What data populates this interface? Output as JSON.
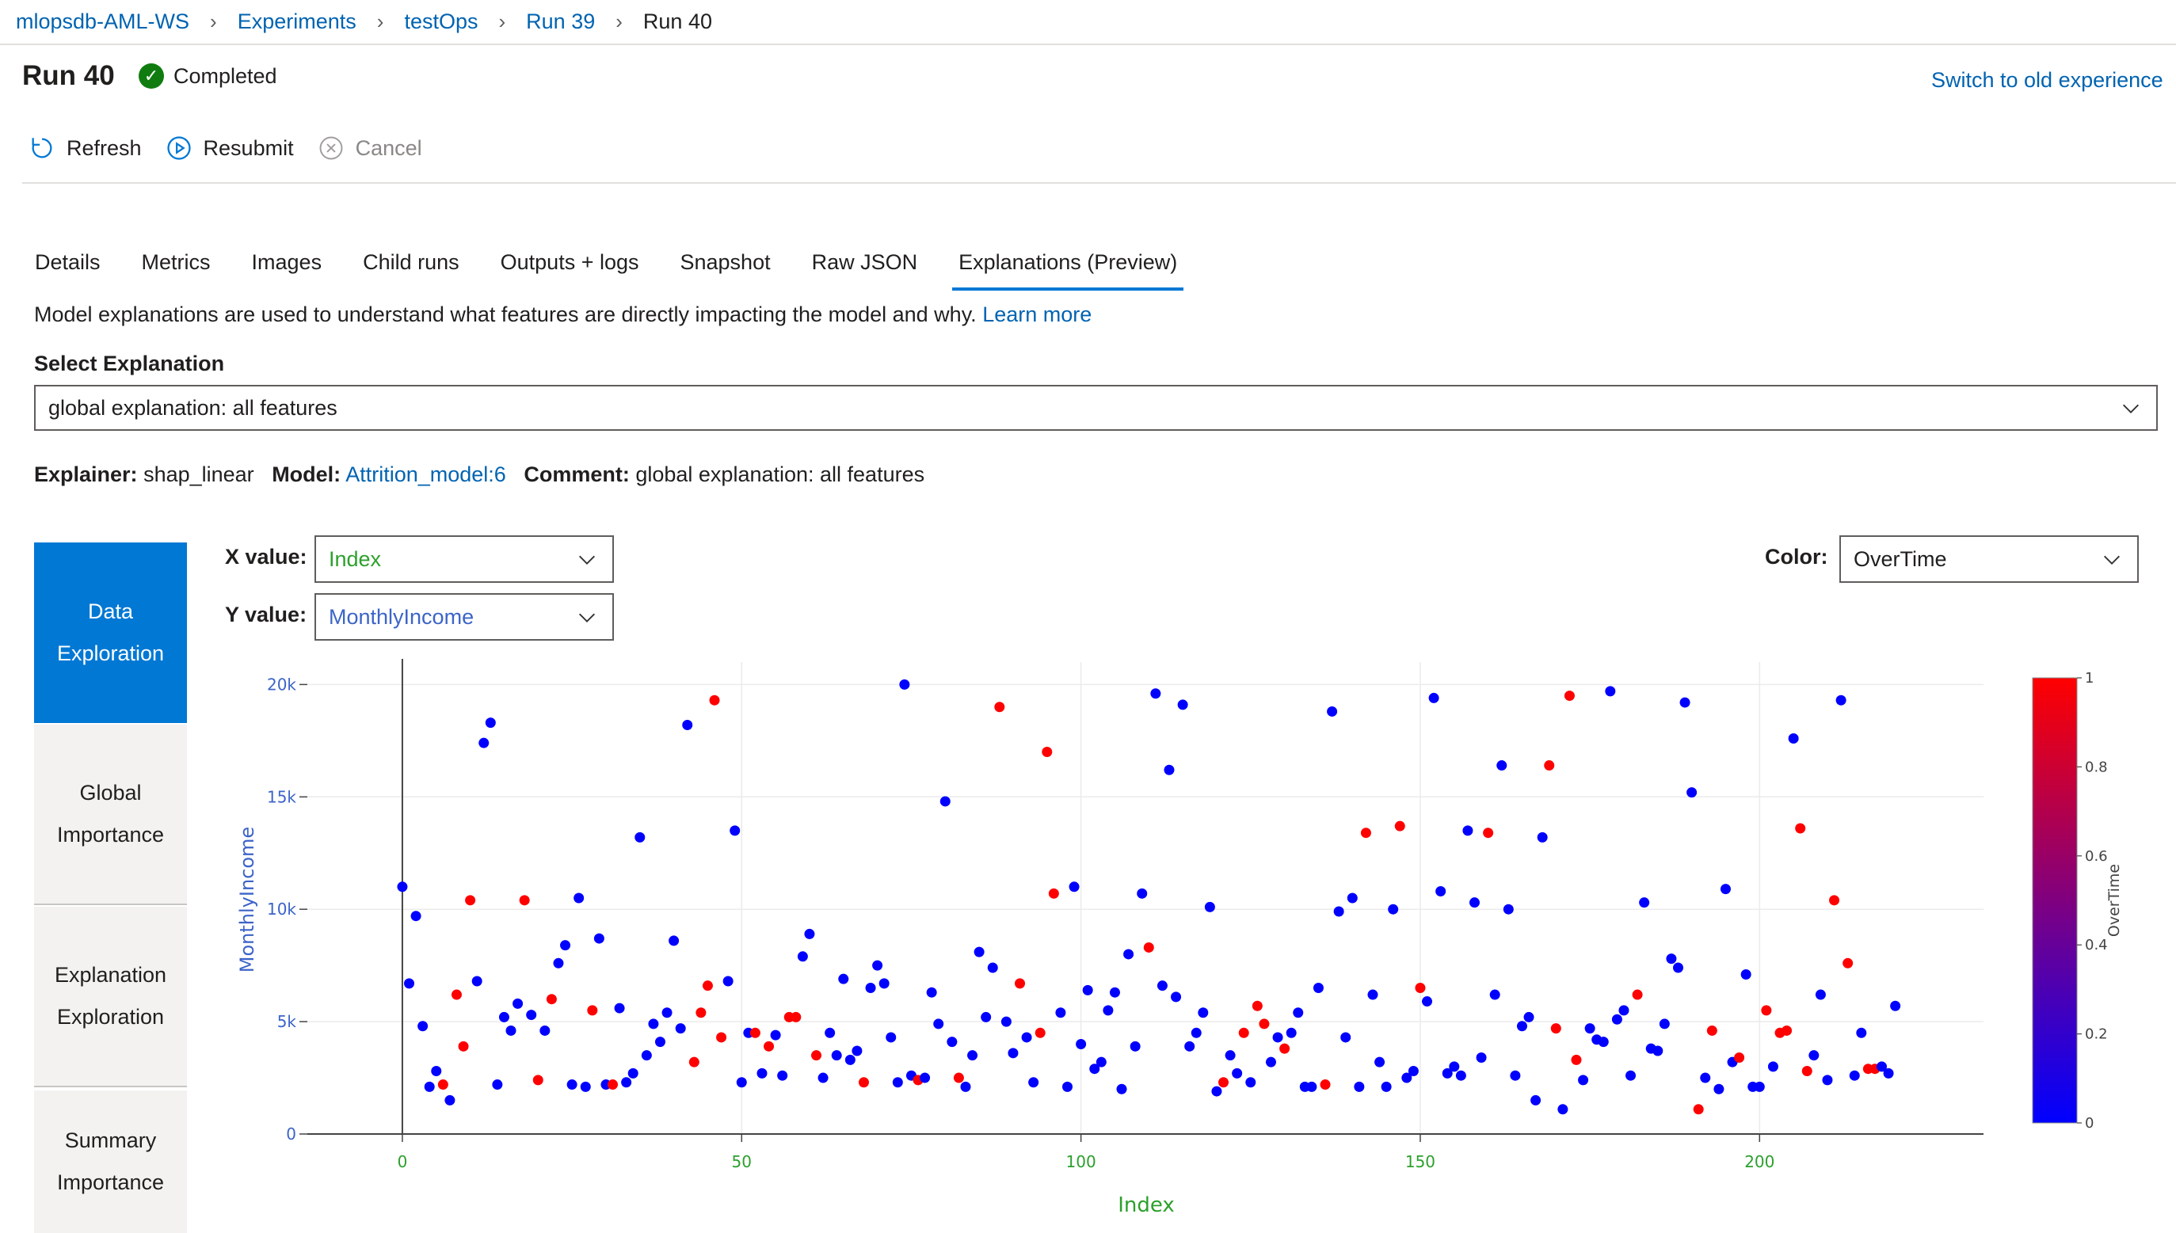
{
  "breadcrumb": [
    "mlopsdb-AML-WS",
    "Experiments",
    "testOps",
    "Run 39",
    "Run 40"
  ],
  "run": {
    "title": "Run 40",
    "status": "Completed"
  },
  "switch_link": "Switch to old experience",
  "commands": {
    "refresh": "Refresh",
    "resubmit": "Resubmit",
    "cancel": "Cancel"
  },
  "tabs": [
    "Details",
    "Metrics",
    "Images",
    "Child runs",
    "Outputs + logs",
    "Snapshot",
    "Raw JSON",
    "Explanations (Preview)"
  ],
  "description": {
    "text": "Model explanations are used to understand what features are directly impacting the model and why.",
    "link": "Learn more"
  },
  "select_explanation": {
    "label": "Select Explanation",
    "value": "global explanation: all features"
  },
  "meta": {
    "explainer_label": "Explainer:",
    "explainer": "shap_linear",
    "model_label": "Model:",
    "model": "Attrition_model:6",
    "comment_label": "Comment:",
    "comment": "global explanation: all features"
  },
  "nav": {
    "data_exploration": [
      "Data",
      "Exploration"
    ],
    "global_importance": [
      "Global",
      "Importance"
    ],
    "explanation_exploration": [
      "Explanation",
      "Exploration"
    ],
    "summary_importance": [
      "Summary",
      "Importance"
    ]
  },
  "controls": {
    "x_label": "X value:",
    "x_value": "Index",
    "y_label": "Y value:",
    "y_value": "MonthlyIncome",
    "color_label": "Color:",
    "color_value": "OverTime"
  },
  "colors": {
    "accent": "#0078d4",
    "link": "#0063b1",
    "x_axis": "#2ca02c",
    "y_axis": "#3c64c8",
    "overtime_no": "#0000ff",
    "overtime_yes": "#ff0000"
  },
  "chart_data": {
    "type": "scatter",
    "xlabel": "Index",
    "ylabel": "MonthlyIncome",
    "xlim": [
      -14,
      233
    ],
    "ylim": [
      0,
      21000
    ],
    "x_ticks": [
      0,
      50,
      100,
      150,
      200
    ],
    "y_ticks": [
      {
        "value": 0,
        "label": "0"
      },
      {
        "value": 5000,
        "label": "5k"
      },
      {
        "value": 10000,
        "label": "10k"
      },
      {
        "value": 15000,
        "label": "15k"
      },
      {
        "value": 20000,
        "label": "20k"
      }
    ],
    "colorbar": {
      "title": "OverTime",
      "range": [
        0,
        1
      ],
      "ticks": [
        "0",
        "0.2",
        "0.4",
        "0.6",
        "0.8",
        "1"
      ]
    },
    "points": [
      [
        0,
        11000,
        0
      ],
      [
        1,
        6700,
        0
      ],
      [
        2,
        9700,
        0
      ],
      [
        3,
        4800,
        0
      ],
      [
        4,
        2100,
        0
      ],
      [
        5,
        2800,
        0
      ],
      [
        6,
        2200,
        1
      ],
      [
        7,
        1500,
        0
      ],
      [
        8,
        6200,
        1
      ],
      [
        9,
        3900,
        1
      ],
      [
        10,
        10400,
        1
      ],
      [
        11,
        6800,
        0
      ],
      [
        12,
        17400,
        0
      ],
      [
        13,
        18300,
        0
      ],
      [
        14,
        2200,
        0
      ],
      [
        15,
        5200,
        0
      ],
      [
        16,
        4600,
        0
      ],
      [
        17,
        5800,
        0
      ],
      [
        18,
        10400,
        1
      ],
      [
        19,
        5300,
        0
      ],
      [
        20,
        2400,
        1
      ],
      [
        21,
        4600,
        0
      ],
      [
        22,
        6000,
        1
      ],
      [
        23,
        7600,
        0
      ],
      [
        24,
        8400,
        0
      ],
      [
        25,
        2200,
        0
      ],
      [
        26,
        10500,
        0
      ],
      [
        27,
        2100,
        0
      ],
      [
        28,
        5500,
        1
      ],
      [
        29,
        8700,
        0
      ],
      [
        30,
        2200,
        0
      ],
      [
        31,
        2200,
        1
      ],
      [
        32,
        5600,
        0
      ],
      [
        33,
        2300,
        0
      ],
      [
        34,
        2700,
        0
      ],
      [
        35,
        13200,
        0
      ],
      [
        36,
        3500,
        0
      ],
      [
        37,
        4900,
        0
      ],
      [
        38,
        4100,
        0
      ],
      [
        39,
        5400,
        0
      ],
      [
        40,
        8600,
        0
      ],
      [
        41,
        4700,
        0
      ],
      [
        42,
        18200,
        0
      ],
      [
        43,
        3200,
        1
      ],
      [
        44,
        5400,
        1
      ],
      [
        45,
        6600,
        1
      ],
      [
        46,
        19300,
        1
      ],
      [
        47,
        4300,
        1
      ],
      [
        48,
        6800,
        0
      ],
      [
        49,
        13500,
        0
      ],
      [
        50,
        2300,
        0
      ],
      [
        51,
        4500,
        0
      ],
      [
        52,
        4500,
        1
      ],
      [
        53,
        2700,
        0
      ],
      [
        54,
        3900,
        1
      ],
      [
        55,
        4400,
        0
      ],
      [
        56,
        2600,
        0
      ],
      [
        57,
        5200,
        1
      ],
      [
        58,
        5200,
        1
      ],
      [
        59,
        7900,
        0
      ],
      [
        60,
        8900,
        0
      ],
      [
        61,
        3500,
        1
      ],
      [
        62,
        2500,
        0
      ],
      [
        63,
        4500,
        0
      ],
      [
        64,
        3500,
        0
      ],
      [
        65,
        6900,
        0
      ],
      [
        66,
        3300,
        0
      ],
      [
        67,
        3700,
        0
      ],
      [
        68,
        2300,
        1
      ],
      [
        69,
        6500,
        0
      ],
      [
        70,
        7500,
        0
      ],
      [
        71,
        6700,
        0
      ],
      [
        72,
        4300,
        0
      ],
      [
        73,
        2300,
        0
      ],
      [
        74,
        20000,
        0
      ],
      [
        75,
        2600,
        0
      ],
      [
        76,
        2400,
        1
      ],
      [
        77,
        2500,
        0
      ],
      [
        78,
        6300,
        0
      ],
      [
        79,
        4900,
        0
      ],
      [
        80,
        14800,
        0
      ],
      [
        81,
        4100,
        0
      ],
      [
        82,
        2500,
        1
      ],
      [
        83,
        2100,
        0
      ],
      [
        84,
        3500,
        0
      ],
      [
        85,
        8100,
        0
      ],
      [
        86,
        5200,
        0
      ],
      [
        87,
        7400,
        0
      ],
      [
        88,
        19000,
        1
      ],
      [
        89,
        5000,
        0
      ],
      [
        90,
        3600,
        0
      ],
      [
        91,
        6700,
        1
      ],
      [
        92,
        4300,
        0
      ],
      [
        93,
        2300,
        0
      ],
      [
        94,
        4500,
        1
      ],
      [
        95,
        17000,
        1
      ],
      [
        96,
        10700,
        1
      ],
      [
        97,
        5400,
        0
      ],
      [
        98,
        2100,
        0
      ],
      [
        99,
        11000,
        0
      ],
      [
        100,
        4000,
        0
      ],
      [
        101,
        6400,
        0
      ],
      [
        102,
        2900,
        0
      ],
      [
        103,
        3200,
        0
      ],
      [
        104,
        5500,
        0
      ],
      [
        105,
        6300,
        0
      ],
      [
        106,
        2000,
        0
      ],
      [
        107,
        8000,
        0
      ],
      [
        108,
        3900,
        0
      ],
      [
        109,
        10700,
        0
      ],
      [
        110,
        8300,
        1
      ],
      [
        111,
        19600,
        0
      ],
      [
        112,
        6600,
        0
      ],
      [
        113,
        16200,
        0
      ],
      [
        114,
        6100,
        0
      ],
      [
        115,
        19100,
        0
      ],
      [
        116,
        3900,
        0
      ],
      [
        117,
        4500,
        0
      ],
      [
        118,
        5400,
        0
      ],
      [
        119,
        10100,
        0
      ],
      [
        120,
        1900,
        0
      ],
      [
        121,
        2300,
        1
      ],
      [
        122,
        3500,
        0
      ],
      [
        123,
        2700,
        0
      ],
      [
        124,
        4500,
        1
      ],
      [
        125,
        2300,
        0
      ],
      [
        126,
        5700,
        1
      ],
      [
        127,
        4900,
        1
      ],
      [
        128,
        3200,
        0
      ],
      [
        129,
        4300,
        0
      ],
      [
        130,
        3800,
        1
      ],
      [
        131,
        4500,
        0
      ],
      [
        132,
        5400,
        0
      ],
      [
        133,
        2100,
        0
      ],
      [
        134,
        2100,
        0
      ],
      [
        135,
        6500,
        0
      ],
      [
        136,
        2200,
        1
      ],
      [
        137,
        18800,
        0
      ],
      [
        138,
        9900,
        0
      ],
      [
        139,
        4300,
        0
      ],
      [
        140,
        10500,
        0
      ],
      [
        141,
        2100,
        0
      ],
      [
        142,
        13400,
        1
      ],
      [
        143,
        6200,
        0
      ],
      [
        144,
        3200,
        0
      ],
      [
        145,
        2100,
        0
      ],
      [
        146,
        10000,
        0
      ],
      [
        147,
        13700,
        1
      ],
      [
        148,
        2500,
        0
      ],
      [
        149,
        2800,
        0
      ],
      [
        150,
        6500,
        1
      ],
      [
        151,
        5900,
        0
      ],
      [
        152,
        19400,
        0
      ],
      [
        153,
        10800,
        0
      ],
      [
        154,
        2700,
        0
      ],
      [
        155,
        3000,
        0
      ],
      [
        156,
        2600,
        0
      ],
      [
        157,
        13500,
        0
      ],
      [
        158,
        10300,
        0
      ],
      [
        159,
        3400,
        0
      ],
      [
        160,
        13400,
        1
      ],
      [
        161,
        6200,
        0
      ],
      [
        162,
        16400,
        0
      ],
      [
        163,
        10000,
        0
      ],
      [
        164,
        2600,
        0
      ],
      [
        165,
        4800,
        0
      ],
      [
        166,
        5200,
        0
      ],
      [
        167,
        1500,
        0
      ],
      [
        168,
        13200,
        0
      ],
      [
        169,
        16400,
        1
      ],
      [
        170,
        4700,
        1
      ],
      [
        171,
        1100,
        0
      ],
      [
        172,
        19500,
        1
      ],
      [
        173,
        3300,
        1
      ],
      [
        174,
        2400,
        0
      ],
      [
        175,
        4700,
        0
      ],
      [
        176,
        4200,
        0
      ],
      [
        177,
        4100,
        0
      ],
      [
        178,
        19700,
        0
      ],
      [
        179,
        5100,
        0
      ],
      [
        180,
        5500,
        0
      ],
      [
        181,
        2600,
        0
      ],
      [
        182,
        6200,
        1
      ],
      [
        183,
        10300,
        0
      ],
      [
        184,
        3800,
        0
      ],
      [
        185,
        3700,
        0
      ],
      [
        186,
        4900,
        0
      ],
      [
        187,
        7800,
        0
      ],
      [
        188,
        7400,
        0
      ],
      [
        189,
        19200,
        0
      ],
      [
        190,
        15200,
        0
      ],
      [
        191,
        1100,
        1
      ],
      [
        192,
        2500,
        0
      ],
      [
        193,
        4600,
        1
      ],
      [
        194,
        2000,
        0
      ],
      [
        195,
        10900,
        0
      ],
      [
        196,
        3200,
        0
      ],
      [
        197,
        3400,
        1
      ],
      [
        198,
        7100,
        0
      ],
      [
        199,
        2100,
        0
      ],
      [
        200,
        2100,
        0
      ],
      [
        201,
        5500,
        1
      ],
      [
        202,
        3000,
        0
      ],
      [
        203,
        4500,
        1
      ],
      [
        204,
        4600,
        1
      ],
      [
        205,
        17600,
        0
      ],
      [
        206,
        13600,
        1
      ],
      [
        207,
        2800,
        1
      ],
      [
        208,
        3500,
        0
      ],
      [
        209,
        6200,
        0
      ],
      [
        210,
        2400,
        0
      ],
      [
        211,
        10400,
        1
      ],
      [
        212,
        19300,
        0
      ],
      [
        213,
        7600,
        1
      ],
      [
        214,
        2600,
        0
      ],
      [
        215,
        4500,
        0
      ],
      [
        216,
        2900,
        1
      ],
      [
        217,
        2900,
        1
      ],
      [
        218,
        3000,
        0
      ],
      [
        219,
        2700,
        0
      ],
      [
        220,
        5700,
        0
      ]
    ]
  }
}
